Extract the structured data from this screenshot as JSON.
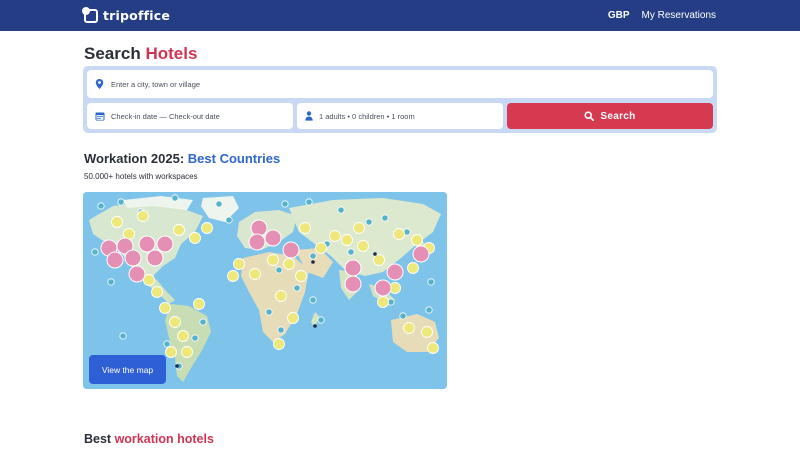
{
  "header": {
    "brand": "tripoffice",
    "currency": "GBP",
    "reservations": "My Reservations"
  },
  "search": {
    "title_plain": "Search ",
    "title_accent": "Hotels",
    "destination_placeholder": "Enter a city, town or village",
    "dates_placeholder": "Check-in date — Check-out date",
    "guests": "1 adults • 0 children • 1 room",
    "button": "Search",
    "icons": {
      "destination": "map-pin-icon",
      "dates": "calendar-icon",
      "guests": "person-icon",
      "button": "search-icon"
    }
  },
  "workation": {
    "title_plain": "Workation 2025: ",
    "title_accent": "Best Countries",
    "subtitle": "50.000+ hotels with workspaces",
    "map_button": "View the map"
  },
  "best": {
    "title_plain": "Best ",
    "title_accent": "workation hotels"
  },
  "colors": {
    "header_bg": "#243d85",
    "accent_red": "#cf3553",
    "accent_blue": "#2f66c9",
    "search_button": "#d63a51",
    "map_button": "#2f5fd4"
  }
}
